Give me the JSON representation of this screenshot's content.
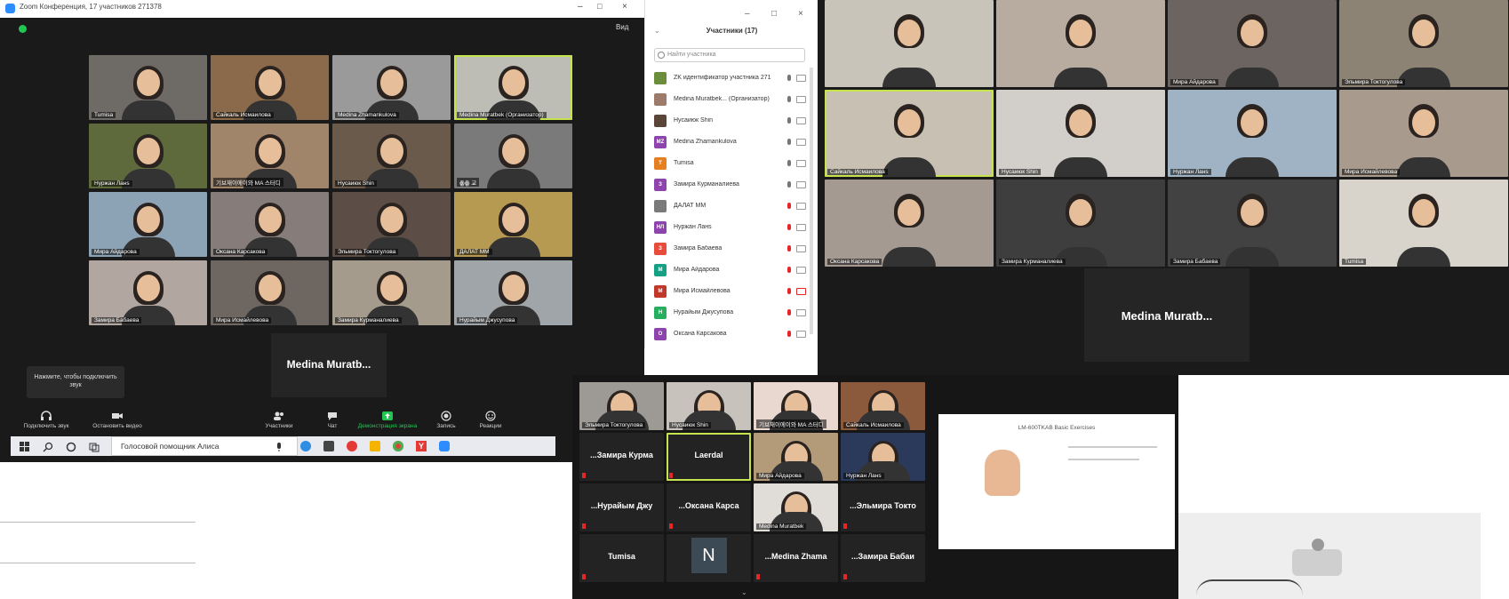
{
  "window_a": {
    "title": "Zoom Конференция, 17 участников 271378",
    "view_label": "Вид"
  },
  "gallery_a": [
    {
      "name": "Tumisa",
      "active": false,
      "bg": "#6e6a66"
    },
    {
      "name": "Сайкаль Исмаилова",
      "active": false,
      "bg": "#8a6a4a"
    },
    {
      "name": "Medina Zhamankulova",
      "active": false,
      "bg": "#9a9a9a"
    },
    {
      "name": "Medina Muratbek (Организатор)",
      "active": true,
      "bg": "#bdbdb5"
    },
    {
      "name": "Нуржан Ланs",
      "active": false,
      "bg": "#5f6a3c"
    },
    {
      "name": "기브재이에이와 MA 스터디",
      "active": false,
      "bg": "#a0856b"
    },
    {
      "name": "Нусаиюк Shin",
      "active": false,
      "bg": "#6a5a4c"
    },
    {
      "name": "ꙮꙮ 교",
      "active": false,
      "bg": "#7a7a7a"
    },
    {
      "name": "Мира Айдарова",
      "active": false,
      "bg": "#8ca3b5"
    },
    {
      "name": "Оксана Карсакова",
      "active": false,
      "bg": "#867c7a"
    },
    {
      "name": "Эльмира Токтогулова",
      "active": false,
      "bg": "#5c4e46"
    },
    {
      "name": "ДАЛАТ MM",
      "active": false,
      "bg": "#b79a52"
    },
    {
      "name": "Замира Бабаева",
      "active": false,
      "bg": "#b2a7a0"
    },
    {
      "name": "Мира Исмайлевова",
      "active": false,
      "bg": "#6e6661"
    },
    {
      "name": "Замира Курманалиева",
      "active": false,
      "bg": "#a59b8d"
    },
    {
      "name": "Нурайым Джусупова",
      "active": false,
      "bg": "#9fa5a8"
    }
  ],
  "name_card_a": "Medina Muratb...",
  "mic_tip": "Нажмите, чтобы подключить звук",
  "toolbar": [
    {
      "label": "Подключить звук",
      "icon": "headphone-icon"
    },
    {
      "label": "Остановить видео",
      "icon": "video-icon"
    },
    {
      "label": "Участники",
      "icon": "participants-icon"
    },
    {
      "label": "Чат",
      "icon": "chat-icon"
    },
    {
      "label": "Демонстрация экрана",
      "icon": "share-screen-icon"
    },
    {
      "label": "Запись",
      "icon": "record-icon"
    },
    {
      "label": "Реакции",
      "icon": "reactions-icon"
    }
  ],
  "panel": {
    "title": "Участники (17)",
    "search_placeholder": "Найти участника",
    "rows": [
      {
        "initials": "",
        "name": "ZK идентификатор участника 271378",
        "color": "#6b8e3d",
        "muted": false,
        "cam_off": false
      },
      {
        "initials": "",
        "name": "Medina Muratbek... (Организатор)",
        "color": "#9c7b6a",
        "muted": false,
        "cam_off": false
      },
      {
        "initials": "",
        "name": "Нусаиюк Shin",
        "color": "#5a4538",
        "muted": false,
        "cam_off": false
      },
      {
        "initials": "MZ",
        "name": "Medina Zhamankulova",
        "color": "#8e44ad",
        "muted": false,
        "cam_off": false
      },
      {
        "initials": "T",
        "name": "Tumisa",
        "color": "#e67e22",
        "muted": false,
        "cam_off": false
      },
      {
        "initials": "З",
        "name": "Замира Курманалиева",
        "color": "#8e44ad",
        "muted": false,
        "cam_off": false
      },
      {
        "initials": "",
        "name": "ДАЛАТ MM",
        "color": "#7a7a7a",
        "muted": true,
        "cam_off": false
      },
      {
        "initials": "НЛ",
        "name": "Нуржан Ланs",
        "color": "#8e44ad",
        "muted": true,
        "cam_off": false
      },
      {
        "initials": "З",
        "name": "Замира Бабаева",
        "color": "#e74c3c",
        "muted": true,
        "cam_off": false
      },
      {
        "initials": "М",
        "name": "Мира Айдарова",
        "color": "#16a085",
        "muted": true,
        "cam_off": false
      },
      {
        "initials": "М",
        "name": "Мира Исмайлевова",
        "color": "#c0392b",
        "muted": true,
        "cam_off": true
      },
      {
        "initials": "Н",
        "name": "Нурайым Джусупова",
        "color": "#27ae60",
        "muted": true,
        "cam_off": false
      },
      {
        "initials": "О",
        "name": "Оксана Карсакова",
        "color": "#8e44ad",
        "muted": true,
        "cam_off": false
      }
    ]
  },
  "taskbar": {
    "search_text": "Голосовой помощник Алиса"
  },
  "gallery_b": [
    {
      "name": "",
      "bg": "#c9c4b9"
    },
    {
      "name": "",
      "bg": "#b8aca0"
    },
    {
      "name": "Мира Айдарова",
      "bg": "#6c6460"
    },
    {
      "name": "Эльмира Токтогулова",
      "bg": "#8d8375"
    },
    {
      "name": "Сайкаль Исмаилова",
      "bg": "#c8c0b2"
    },
    {
      "name": "Нусаиюк Shin",
      "bg": "#d2cfcb"
    },
    {
      "name": "Нуржан Ланs",
      "bg": "#9fb3c4"
    },
    {
      "name": "Мира Исмайлевова",
      "bg": "#a89a8c"
    },
    {
      "name": "Оксана Карсакова",
      "bg": "#a59a92"
    },
    {
      "name": "Замира Курманалиева",
      "bg": "#3e3e3e"
    },
    {
      "name": "Замира Бабаева",
      "bg": "#424242"
    },
    {
      "name": "Tumisa",
      "bg": "#d8d4cc"
    }
  ],
  "name_card_b": "Medina  Muratb...",
  "gallery_c": [
    {
      "name": "Эльмира Токтогулова",
      "kind": "video",
      "bg": "#9d9a96"
    },
    {
      "name": "Нусаиюк Shin",
      "kind": "video",
      "bg": "#c7c2bb"
    },
    {
      "name": "기브재이에이와 MA 스터디",
      "kind": "video",
      "bg": "#e9d8d0"
    },
    {
      "name": "Сайкаль Исмаилова",
      "kind": "video",
      "bg": "#8b5a3c"
    },
    {
      "name": "Замира Курма...",
      "kind": "text",
      "bg": "#232323"
    },
    {
      "name": "Laerdal",
      "kind": "text-active",
      "bg": "#232323"
    },
    {
      "name": "Мира Айдарова",
      "kind": "video",
      "bg": "#b39b7a"
    },
    {
      "name": "Нуржан Ланs",
      "kind": "video",
      "bg": "#2b3a5a"
    },
    {
      "name": "Нурайым Джу...",
      "kind": "text",
      "bg": "#232323"
    },
    {
      "name": "Оксана Карса...",
      "kind": "text",
      "bg": "#232323"
    },
    {
      "name": "Medina Muratbek",
      "kind": "video",
      "bg": "#e0dcd8"
    },
    {
      "name": "Эльмира Токто...",
      "kind": "text",
      "bg": "#232323"
    },
    {
      "name": "Tumisa",
      "kind": "text",
      "bg": "#232323"
    },
    {
      "name": "N",
      "kind": "avatar",
      "bg": "#232323"
    },
    {
      "name": "Medina Zhama...",
      "kind": "text",
      "bg": "#232323"
    },
    {
      "name": "Замира Бабаи...",
      "kind": "text",
      "bg": "#232323"
    }
  ],
  "slide_title": "LM-600TKAB Basic Exercises"
}
